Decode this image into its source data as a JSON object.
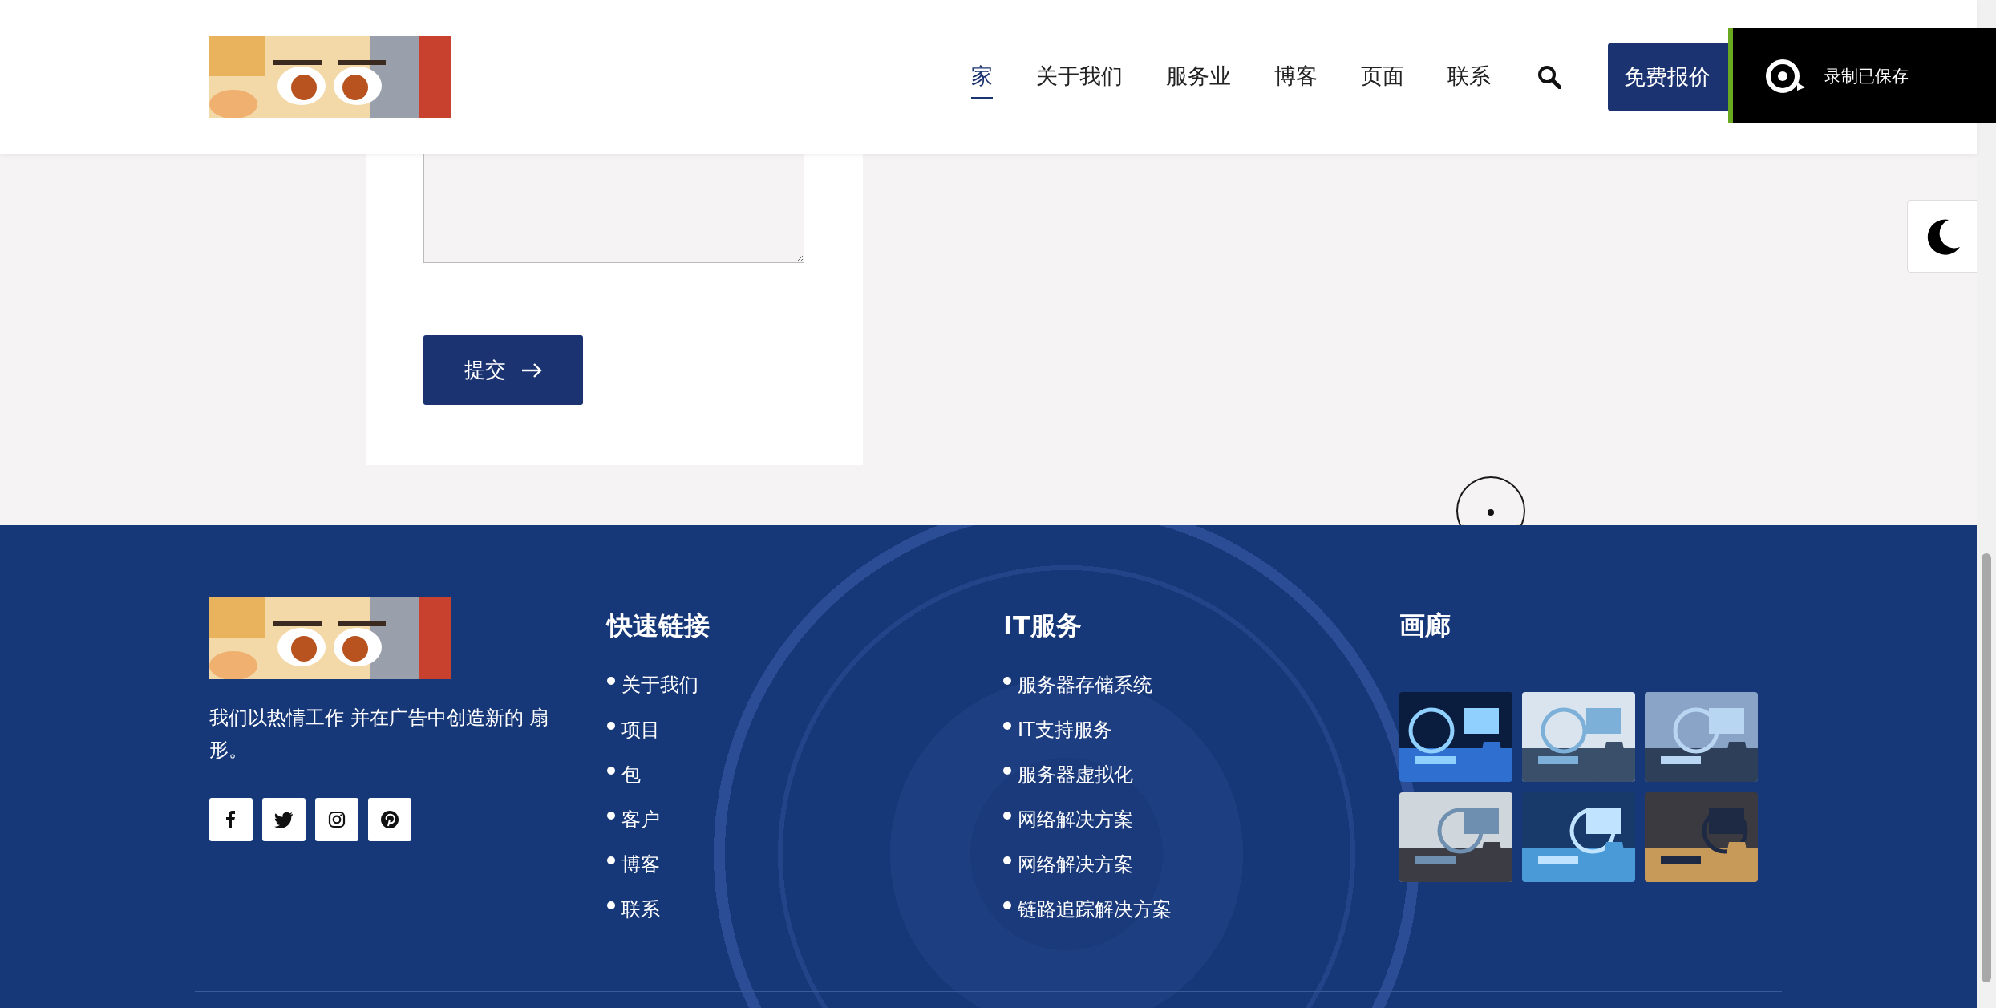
{
  "header": {
    "nav": [
      {
        "label": "家",
        "selected": true
      },
      {
        "label": "关于我们",
        "selected": false
      },
      {
        "label": "服务业",
        "selected": false
      },
      {
        "label": "博客",
        "selected": false
      },
      {
        "label": "页面",
        "selected": false
      },
      {
        "label": "联系",
        "selected": false
      }
    ],
    "quote_button": "免费报价"
  },
  "form": {
    "submit": "提交"
  },
  "toast": {
    "text": "录制已保存"
  },
  "footer": {
    "about": "我们以热情工作 并在广告中创造新的 扇形。",
    "columns": [
      {
        "title": "快速链接",
        "links": [
          "关于我们",
          "项目",
          "包",
          "客户",
          "博客",
          "联系"
        ]
      },
      {
        "title": "IT服务",
        "links": [
          "服务器存储系统",
          "IT支持服务",
          "服务器虚拟化",
          "网络解决方案",
          "网络解决方案",
          "链路追踪解决方案"
        ]
      }
    ],
    "gallery": {
      "title": "画廊"
    }
  }
}
